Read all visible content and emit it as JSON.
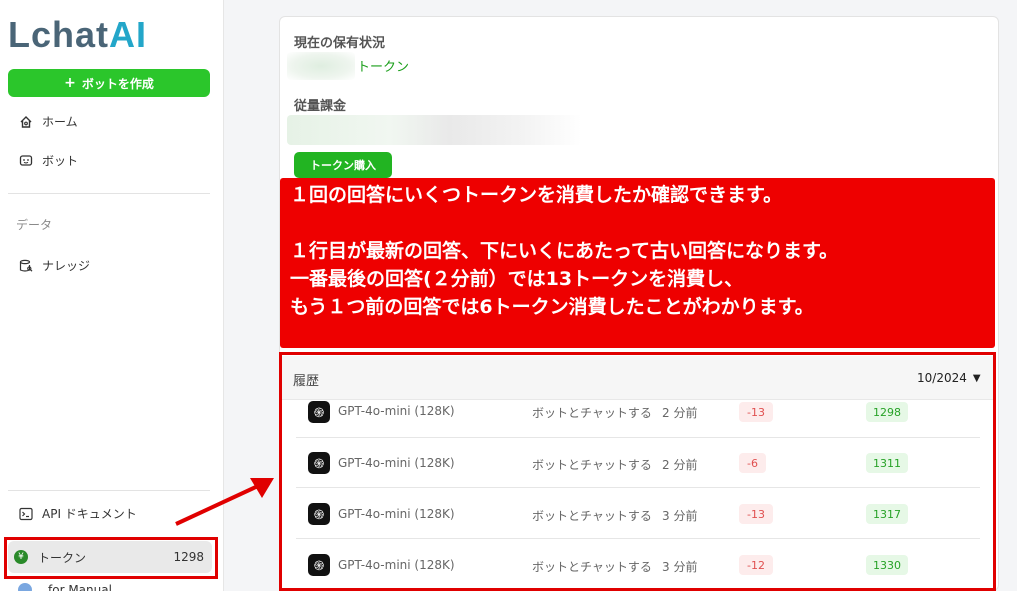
{
  "sidebar": {
    "logo_main": "Lchat",
    "logo_ai": "AI",
    "create_bot": "ボットを作成",
    "nav": [
      {
        "label": "ホーム",
        "icon": "home-icon"
      },
      {
        "label": "ボット",
        "icon": "bot-icon"
      }
    ],
    "data_section": "データ",
    "knowledge": "ナレッジ",
    "api_docs": "API ドキュメント",
    "token": {
      "label": "トークン",
      "count": "1298"
    },
    "user": "for Manual"
  },
  "holdings": {
    "title": "現在の保有状況",
    "token_suffix": "トークン",
    "metered_title": "従量課金",
    "buy_button": "トークン購入"
  },
  "annotation": {
    "line1": "１回の回答にいくつトークンを消費したか確認できます。",
    "line2": "",
    "line3": "１行目が最新の回答、下にいくにあたって古い回答になります。",
    "line4": "一番最後の回答(２分前）では13トークンを消費し、",
    "line5": "もう１つ前の回答では6トークン消費したことがわかります。"
  },
  "history": {
    "title": "履歴",
    "month": "10/2024",
    "rows": [
      {
        "model": "GPT-4o-mini (128K)",
        "action": "ボットとチャットする",
        "time": "2 分前",
        "delta": "-13",
        "balance": "1298"
      },
      {
        "model": "GPT-4o-mini (128K)",
        "action": "ボットとチャットする",
        "time": "2 分前",
        "delta": "-6",
        "balance": "1311"
      },
      {
        "model": "GPT-4o-mini (128K)",
        "action": "ボットとチャットする",
        "time": "3 分前",
        "delta": "-13",
        "balance": "1317"
      },
      {
        "model": "GPT-4o-mini (128K)",
        "action": "ボットとチャットする",
        "time": "3 分前",
        "delta": "-12",
        "balance": "1330"
      }
    ]
  },
  "colors": {
    "accent_green": "#2bc62b",
    "annotation_red": "#ee0000",
    "logo_dark": "#4a6577",
    "logo_ai": "#23a6c9"
  }
}
